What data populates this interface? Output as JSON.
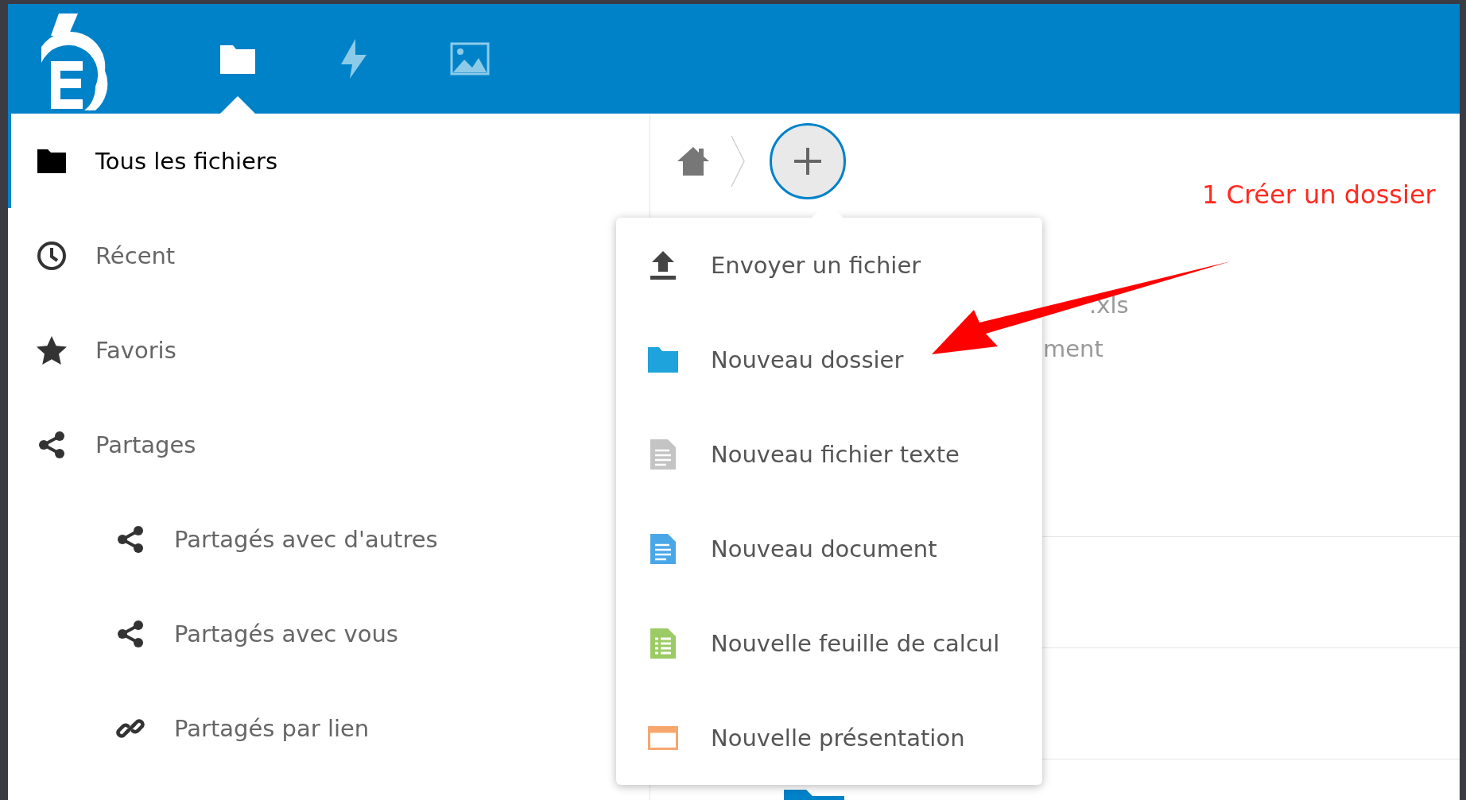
{
  "header": {
    "nav": [
      {
        "kind": "files",
        "selected": true
      },
      {
        "kind": "activity",
        "selected": false
      },
      {
        "kind": "gallery",
        "selected": false
      }
    ]
  },
  "sidebar": {
    "items": [
      {
        "label": "Tous les fichiers",
        "kind": "folder",
        "selected": true
      },
      {
        "label": "Récent",
        "kind": "clock",
        "selected": false
      },
      {
        "label": "Favoris",
        "kind": "star",
        "selected": false
      },
      {
        "label": "Partages",
        "kind": "share",
        "selected": false,
        "children": [
          {
            "label": "Partagés avec d'autres",
            "kind": "share",
            "selected": false
          },
          {
            "label": "Partagés avec vous",
            "kind": "share",
            "selected": false
          },
          {
            "label": "Partagés par lien",
            "kind": "link",
            "selected": false
          }
        ]
      }
    ]
  },
  "files": {
    "rows": [
      {
        "name": ".xls",
        "detail": "ment"
      },
      {},
      {},
      {
        "kind": "folder"
      }
    ]
  },
  "new_menu": {
    "items": [
      {
        "label": "Envoyer un fichier",
        "kind": "upload"
      },
      {
        "label": "Nouveau dossier",
        "kind": "folder"
      },
      {
        "label": "Nouveau fichier texte",
        "kind": "text"
      },
      {
        "label": "Nouveau document",
        "kind": "document"
      },
      {
        "label": "Nouvelle feuille de calcul",
        "kind": "spreadsheet"
      },
      {
        "label": "Nouvelle présentation",
        "kind": "presentation"
      }
    ]
  },
  "annotation": {
    "text": "1 Créer un dossier"
  }
}
